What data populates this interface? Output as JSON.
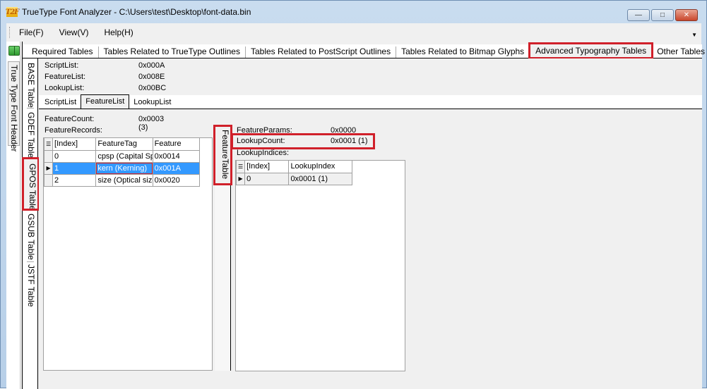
{
  "window": {
    "app_icon_label": "T2F",
    "title": "TrueType Font Analyzer - C:\\Users\\test\\Desktop\\font-data.bin",
    "controls": {
      "minimize": "—",
      "maximize": "□",
      "close": "✕"
    }
  },
  "menu": {
    "items": [
      "File(F)",
      "View(V)",
      "Help(H)"
    ],
    "overflow_icon": "▼"
  },
  "left_strip": {
    "icon": "book-icon",
    "tab_label": "True Type Font Header"
  },
  "top_tabs": [
    {
      "label": "Required Tables",
      "active": false
    },
    {
      "label": "Tables Related to TrueType Outlines",
      "active": false
    },
    {
      "label": "Tables Related to PostScript Outlines",
      "active": false
    },
    {
      "label": "Tables Related to Bitmap Glyphs",
      "active": false
    },
    {
      "label": "Advanced Typography Tables",
      "active": true,
      "highlighted": true
    },
    {
      "label": "Other Tables",
      "active": false
    }
  ],
  "table_tabs": [
    {
      "label": "BASE Table",
      "active": false
    },
    {
      "label": "GDEF Table",
      "active": false
    },
    {
      "label": "GPOS Table",
      "active": true,
      "highlighted": true
    },
    {
      "label": "GSUB Table",
      "active": false
    },
    {
      "label": "JSTF Table",
      "active": false
    }
  ],
  "gpos_header": {
    "fields": [
      {
        "key": "ScriptList:",
        "value": "0x000A"
      },
      {
        "key": "FeatureList:",
        "value": "0x008E"
      },
      {
        "key": "LookupList:",
        "value": "0x00BC"
      }
    ]
  },
  "sub_tabs": [
    {
      "label": "ScriptList",
      "active": false
    },
    {
      "label": "FeatureList",
      "active": true
    },
    {
      "label": "LookupList",
      "active": false
    }
  ],
  "feature_list": {
    "feature_count_label": "FeatureCount:",
    "feature_count_value": "0x0003 (3)",
    "feature_records_label": "FeatureRecords:",
    "columns": [
      "[Index]",
      "FeatureTag",
      "Feature"
    ],
    "rows": [
      {
        "index": "0",
        "tag": "cpsp (Capital Sp",
        "feature": "0x0014",
        "selected": false
      },
      {
        "index": "1",
        "tag": "kern (Kerning)",
        "feature": "0x001A",
        "selected": true
      },
      {
        "index": "2",
        "tag": "size (Optical size",
        "feature": "0x0020",
        "selected": false
      }
    ]
  },
  "feature_table": {
    "tab_label": "FeatureTable",
    "fields": [
      {
        "key": "FeatureParams:",
        "value": "0x0000"
      },
      {
        "key": "LookupCount:",
        "value": "0x0001 (1)"
      }
    ],
    "lookup_indices_label": "LookupIndices:",
    "columns": [
      "[Index]",
      "LookupIndex"
    ],
    "rows": [
      {
        "index": "0",
        "lookup_index": "0x0001 (1)"
      }
    ]
  }
}
